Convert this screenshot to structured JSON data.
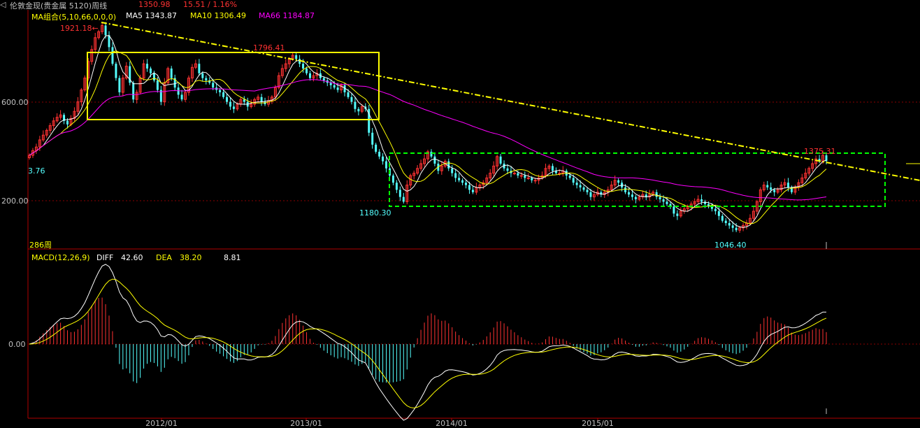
{
  "header": {
    "instrument": "伦敦金现(贵金属 5120)周线",
    "price": "1350.98",
    "change": "15.51 / 1.16%"
  },
  "main_panel": {
    "ma_title": "MA组合(5,10,66,0,0,0)",
    "ma5_label": "MA5 1343.87",
    "ma10_label": "MA10 1306.49",
    "ma66_label": "MA66 1184.87",
    "bar_count_label": "286周",
    "start_value_label": "3.76"
  },
  "macd_panel": {
    "title": "MACD(12,26,9)",
    "diff_label": "DIFF",
    "diff_value": "42.60",
    "dea_label": "DEA",
    "dea_value": "38.20",
    "macd_value": "8.81"
  },
  "colors": {
    "up": "#ff3232",
    "down": "#54ffff",
    "ma5": "#ffffff",
    "ma10": "#ffff00",
    "ma66": "#ff00ff",
    "trendline": "#ffff00",
    "box_upper": "#ffff00",
    "box_lower": "#00ff00",
    "grid": "#8b0000"
  },
  "chart_data": [
    {
      "type": "candlestick",
      "title": "伦敦金现(贵金属 5120)周线",
      "y_ticks": [
        "600.00",
        "200.00"
      ],
      "y_range": [
        1040,
        1940
      ],
      "x_ticks": [
        "2012/01",
        "2013/01",
        "2014/01",
        "2015/01"
      ],
      "annotations": [
        {
          "text": "1921.18",
          "x": "2011/09",
          "y": 1921.18
        },
        {
          "text": "1796.41",
          "x": "2012/10",
          "y": 1796.41
        },
        {
          "text": "1180.30",
          "x": "2013/06",
          "y": 1180.3
        },
        {
          "text": "1046.40",
          "x": "2015/12",
          "y": 1046.4
        },
        {
          "text": "1375.31",
          "x": "2016/07",
          "y": 1375.31
        }
      ],
      "series": [
        {
          "name": "MA5",
          "value": 1343.87
        },
        {
          "name": "MA10",
          "value": 1306.49
        },
        {
          "name": "MA66",
          "value": 1184.87
        }
      ],
      "weekly_close": [
        1375,
        1395,
        1410,
        1440,
        1460,
        1480,
        1500,
        1520,
        1535,
        1545,
        1520,
        1505,
        1530,
        1560,
        1600,
        1650,
        1700,
        1770,
        1820,
        1870,
        1895,
        1921,
        1880,
        1830,
        1760,
        1700,
        1640,
        1700,
        1750,
        1680,
        1610,
        1640,
        1700,
        1760,
        1740,
        1720,
        1690,
        1650,
        1600,
        1680,
        1740,
        1700,
        1660,
        1630,
        1610,
        1640,
        1700,
        1745,
        1760,
        1720,
        1700,
        1690,
        1680,
        1660,
        1650,
        1640,
        1620,
        1600,
        1580,
        1570,
        1590,
        1610,
        1600,
        1580,
        1590,
        1610,
        1620,
        1600,
        1590,
        1605,
        1620,
        1660,
        1710,
        1740,
        1760,
        1780,
        1796,
        1780,
        1760,
        1740,
        1720,
        1700,
        1710,
        1720,
        1700,
        1690,
        1680,
        1670,
        1660,
        1650,
        1670,
        1640,
        1620,
        1600,
        1570,
        1560,
        1580,
        1570,
        1470,
        1420,
        1390,
        1370,
        1350,
        1320,
        1290,
        1260,
        1230,
        1200,
        1180,
        1250,
        1290,
        1300,
        1320,
        1340,
        1360,
        1390,
        1370,
        1340,
        1310,
        1330,
        1350,
        1320,
        1300,
        1280,
        1270,
        1260,
        1250,
        1230,
        1220,
        1240,
        1250,
        1260,
        1280,
        1300,
        1330,
        1370,
        1340,
        1320,
        1310,
        1300,
        1300,
        1290,
        1290,
        1280,
        1280,
        1270,
        1270,
        1280,
        1290,
        1320,
        1330,
        1310,
        1300,
        1300,
        1310,
        1290,
        1280,
        1260,
        1250,
        1240,
        1230,
        1220,
        1200,
        1210,
        1220,
        1210,
        1220,
        1230,
        1250,
        1270,
        1260,
        1240,
        1220,
        1210,
        1200,
        1190,
        1200,
        1210,
        1200,
        1210,
        1220,
        1200,
        1190,
        1180,
        1170,
        1160,
        1130,
        1120,
        1140,
        1150,
        1160,
        1170,
        1180,
        1190,
        1180,
        1170,
        1160,
        1150,
        1140,
        1120,
        1100,
        1090,
        1080,
        1070,
        1060,
        1070,
        1080,
        1090,
        1110,
        1140,
        1180,
        1230,
        1250,
        1240,
        1230,
        1220,
        1230,
        1250,
        1260,
        1240,
        1220,
        1240,
        1260,
        1280,
        1300,
        1320,
        1340,
        1360,
        1350,
        1375,
        1351
      ]
    },
    {
      "type": "bar+line",
      "title": "MACD(12,26,9)",
      "y_ticks": [
        "0.00"
      ],
      "series": [
        {
          "name": "DIFF",
          "value": 42.6
        },
        {
          "name": "DEA",
          "value": 38.2
        },
        {
          "name": "MACD",
          "value": 8.81
        }
      ]
    }
  ]
}
